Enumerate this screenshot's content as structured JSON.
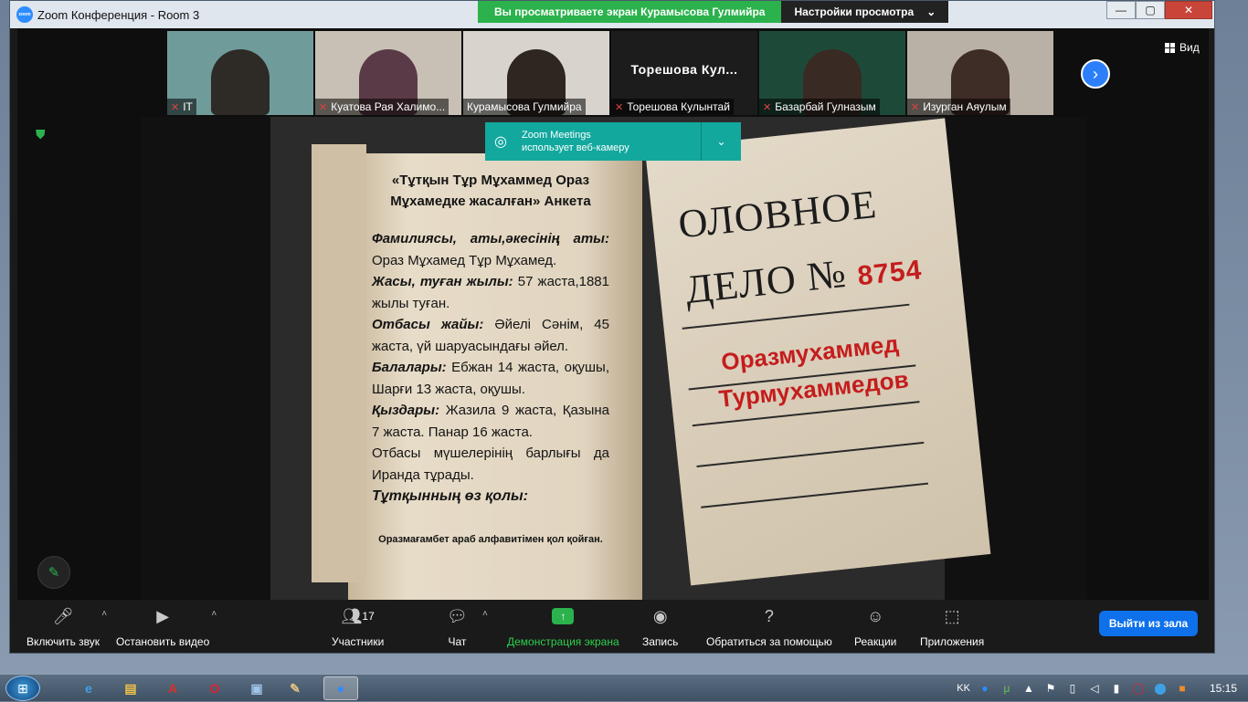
{
  "window": {
    "title": "Zoom Конференция - Room 3",
    "minimize": "—",
    "maximize": "▢",
    "close": "✕"
  },
  "share_banner": {
    "message": "Вы просматриваете экран Курамысова Гулмийра",
    "options_label": "Настройки просмотра",
    "options_caret": "⌄"
  },
  "gallery": {
    "view_label": "Вид",
    "next_icon": "›",
    "participants": [
      {
        "name": "IT",
        "muted": true,
        "video": true,
        "bg": "#6f9c9a",
        "person": "#2e2a26"
      },
      {
        "name": "Куатова Рая Халимо...",
        "muted": true,
        "video": true,
        "bg": "#c8c0b4",
        "person": "#5b3a48"
      },
      {
        "name": "Курамысова Гулмийра",
        "muted": false,
        "video": true,
        "bg": "#d8d4cd",
        "person": "#2f2621"
      },
      {
        "name": "Торешова Кулынтай",
        "muted": true,
        "video": false,
        "display_name": "Торешова Кул..."
      },
      {
        "name": "Базарбай Гулназым",
        "muted": true,
        "video": true,
        "bg": "#1d4a38",
        "person": "#3a2a24"
      },
      {
        "name": "Изурган Аяулым",
        "muted": true,
        "video": true,
        "bg": "#b9b1a6",
        "person": "#3e2c26"
      }
    ],
    "mute_icon": "🎤︎"
  },
  "webcam_notice": {
    "title": "Zoom Meetings",
    "subtitle": "использует веб-камеру",
    "chevron": "⌄"
  },
  "shared_content": {
    "doc_title": "«Тұтқын Тұр Мұхаммед Ораз Мұхамедке жасалған» Анкета",
    "rows": [
      {
        "label": "Фамилиясы, аты,әкесінің аты:",
        "text": "Ораз Мұхамед Тұр Мұхамед."
      },
      {
        "label": "Жасы, туған жылы:",
        "text": "57 жаста,1881 жылы туған."
      },
      {
        "label": "Отбасы жайы:",
        "text": "Әйелі Сәнім, 45 жаста, үй шаруасындағы әйел."
      },
      {
        "label": "Балалары:",
        "text": "Ебжан 14 жаста, оқушы, Шарғи 13 жаста, оқушы."
      },
      {
        "label": "Қыздары:",
        "text": "Жазила 9 жаста, Қазына 7 жаста. Панар 16 жаста."
      }
    ],
    "family_note": "Отбасы мүшелерінің барлығы да Иранда тұрады.",
    "signature_label": "Тұтқынның өз қолы:",
    "signature_note": "Оразмағамбет араб алфавитімен қол қойған.",
    "case_line1": "ОЛОВНОЕ",
    "case_line2": "ДЕЛО №",
    "case_number": "8754",
    "case_name1": "Оразмухаммед",
    "case_name2": "Турмухаммедов"
  },
  "toolbar": {
    "items": [
      {
        "label": "Включить звук",
        "icon": "🎤︎"
      },
      {
        "label": "Остановить видео",
        "icon": "▶"
      },
      {
        "label": "Участники",
        "icon": "👥︎",
        "count": "17"
      },
      {
        "label": "Чат",
        "icon": "💬︎"
      },
      {
        "label": "Демонстрация экрана",
        "icon": "↑"
      },
      {
        "label": "Запись",
        "icon": "◉"
      },
      {
        "label": "Обратиться за помощью",
        "icon": "?"
      },
      {
        "label": "Реакции",
        "icon": "☺"
      },
      {
        "label": "Приложения",
        "icon": "⬚"
      }
    ],
    "caret": "˄",
    "leave_label": "Выйти из зала"
  },
  "taskbar": {
    "start_icon": "⊞",
    "apps": [
      {
        "name": "ie",
        "glyph": "e",
        "color": "#3ea1e6"
      },
      {
        "name": "explorer",
        "glyph": "▤",
        "color": "#f0c24b"
      },
      {
        "name": "acrobat",
        "glyph": "A",
        "color": "#d93025"
      },
      {
        "name": "opera",
        "glyph": "O",
        "color": "#e0212f"
      },
      {
        "name": "remote",
        "glyph": "▣",
        "color": "#9fc5e8"
      },
      {
        "name": "paint",
        "glyph": "✎",
        "color": "#e0c080"
      },
      {
        "name": "zoom",
        "glyph": "●",
        "color": "#2d8cff"
      }
    ],
    "lang": "KK",
    "time": "15:15"
  },
  "colors": {
    "accent_blue": "#0e71eb",
    "share_green": "#2bb24c",
    "webcam_teal": "#13a89e",
    "case_red": "#c41d1d"
  }
}
